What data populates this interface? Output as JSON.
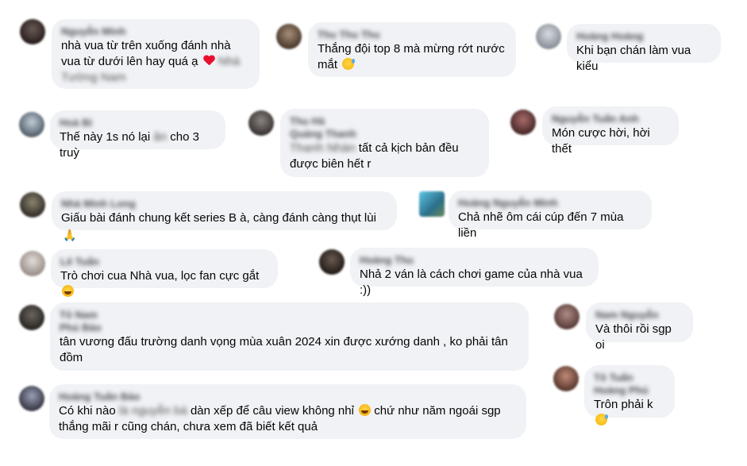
{
  "comments": [
    {
      "id": "c1",
      "name": "Nguyễn Minh",
      "lines": [
        "nhà vua từ trên xuống đánh nhà",
        "vua từ dưới lên hay quá ạ "
      ],
      "trail_emoji": "heart",
      "trail_blur": "Nhà",
      "extra_name_line": "Tường Nam",
      "avatar_color": "#3a2f2f"
    },
    {
      "id": "c2",
      "name": "Thu Thu Thu",
      "lines": [
        "Thắng đội top 8 mà mừng rớt nước",
        "mắt "
      ],
      "trail_emoji": "sweat",
      "avatar_color": "#5a4a3c"
    },
    {
      "id": "c3",
      "name": "Hoàng Hoàng",
      "lines": [
        "Khi bạn chán làm vua kiểu"
      ],
      "avatar_color": "#9aa0a8"
    },
    {
      "id": "c4",
      "name": "Hoà Bi",
      "lines": [
        "Thế này 1s nó lại "
      ],
      "mid_blur": "ăn",
      "after_blur": " cho 3 truỳ",
      "avatar_color": "#6c7a86"
    },
    {
      "id": "c5",
      "name": "Thu Hà",
      "extra_name_line": "Quảng Thanh",
      "blur_prefix": "Thanh Nhàn",
      "lines": [
        " tất cả kịch bản đều",
        "được biên hết r"
      ],
      "avatar_color": "#4d4a48"
    },
    {
      "id": "c6",
      "name": "Nguyễn Tuấn Anh",
      "lines": [
        "Món cược hời, hời thết"
      ],
      "avatar_color": "#6b3b3b"
    },
    {
      "id": "c7",
      "name": "Nhà Minh Long",
      "lines": [
        "Giấu bài đánh chung kết series B à, càng đánh càng thụt lùi "
      ],
      "trail_emoji": "pray",
      "avatar_color": "#4e4a3e"
    },
    {
      "id": "c8",
      "name": "Hoàng Nguyễn Minh",
      "lines": [
        "Chả nhẽ ôm cái cúp đến 7 mùa liền"
      ],
      "avatar_color": "#3f8fb0"
    },
    {
      "id": "c9",
      "name": "Lê Tuấn",
      "lines": [
        "Trò chơi cua Nhà vua, lọc fan cực gắt "
      ],
      "trail_emoji": "laugh",
      "avatar_color": "#a8a2a0"
    },
    {
      "id": "c10",
      "name": "Hoàng Thu",
      "lines": [
        "Nhả 2 ván là cách chơi game của nhà vua :))"
      ],
      "avatar_color": "#3a2e2a"
    },
    {
      "id": "c11",
      "name": "Tô Nam",
      "extra_name_line": "Phú Bảo",
      "lines": [
        "tân vương đấu trường danh vọng mùa xuân 2024 xin được xướng danh , ko phải tân",
        "đồm"
      ],
      "avatar_color": "#3d3a36"
    },
    {
      "id": "c12",
      "name": "Nam Nguyễn",
      "lines": [
        "Và thôi rồi sgp oi"
      ],
      "avatar_color": "#7a5a56"
    },
    {
      "id": "c13",
      "name": "Hoàng Tuấn Bảo",
      "lines": [
        "Có khi nào "
      ],
      "mid_blur": "là nguyễn bá",
      "after_blur": " dàn xếp để câu view không nhỉ ",
      "trail_emoji": "laugh",
      "after_emoji": " chứ như năm ngoái sgp",
      "lines2": [
        "thắng mãi r cũng chán, chưa xem đã biết kết quả"
      ],
      "avatar_color": "#5a5a66"
    },
    {
      "id": "c14",
      "name": "Tô Tuấn",
      "extra_name_line": "Hoàng Phú",
      "lines": [
        "Trôn phải k"
      ],
      "trail_emoji": "sweat",
      "avatar_color": "#8a5a4a"
    }
  ]
}
